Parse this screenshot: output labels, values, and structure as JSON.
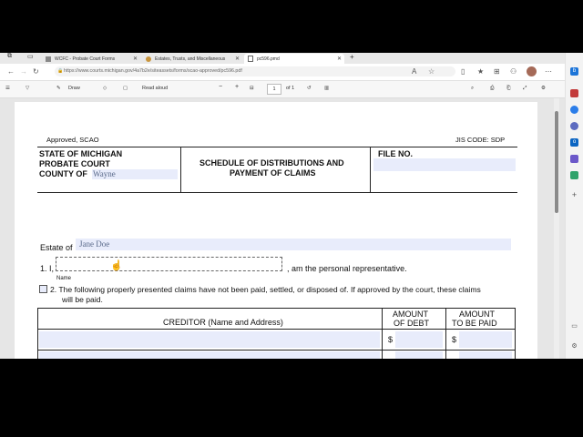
{
  "browser": {
    "tabs": [
      {
        "label": "WCFC - Probate Court Forms",
        "active": false
      },
      {
        "label": "Estates, Trusts, and Miscellaneous",
        "active": false
      },
      {
        "label": "pc596.pmd",
        "active": true
      }
    ],
    "new_tab": "+",
    "url": "https://www.courts.michigan.gov/4a7b2e/siteassets/forms/scao-approved/pc596.pdf"
  },
  "pdf_toolbar": {
    "draw_label": "Draw",
    "read_aloud_label": "Read aloud",
    "zoom_minus": "−",
    "zoom_plus": "+",
    "page_current": "1",
    "page_total": "of 1"
  },
  "form": {
    "approved": "Approved, SCAO",
    "jis_code": "JIS CODE:  SDP",
    "court_line1": "STATE OF MICHIGAN",
    "court_line2": "PROBATE COURT",
    "court_line3": "COUNTY OF",
    "county_value": "Wayne",
    "title_line1": "SCHEDULE OF DISTRIBUTIONS AND",
    "title_line2": "PAYMENT OF CLAIMS",
    "file_no": "FILE NO.",
    "estate_of": "Estate of",
    "estate_value": "Jane Doe",
    "item1_num": "1.  I,",
    "item1_suffix": ", am the personal representative.",
    "name_caption": "Name",
    "item2_line1": "2.  The following properly presented claims have not been paid, settled, or disposed of.  If approved by the court, these claims",
    "item2_line2": "will be paid.",
    "table": {
      "col_creditor": "CREDITOR (Name and Address)",
      "col_amount_debt_1": "AMOUNT",
      "col_amount_debt_2": "OF DEBT",
      "col_amount_paid_1": "AMOUNT",
      "col_amount_paid_2": "TO BE PAID",
      "dollar": "$"
    }
  }
}
